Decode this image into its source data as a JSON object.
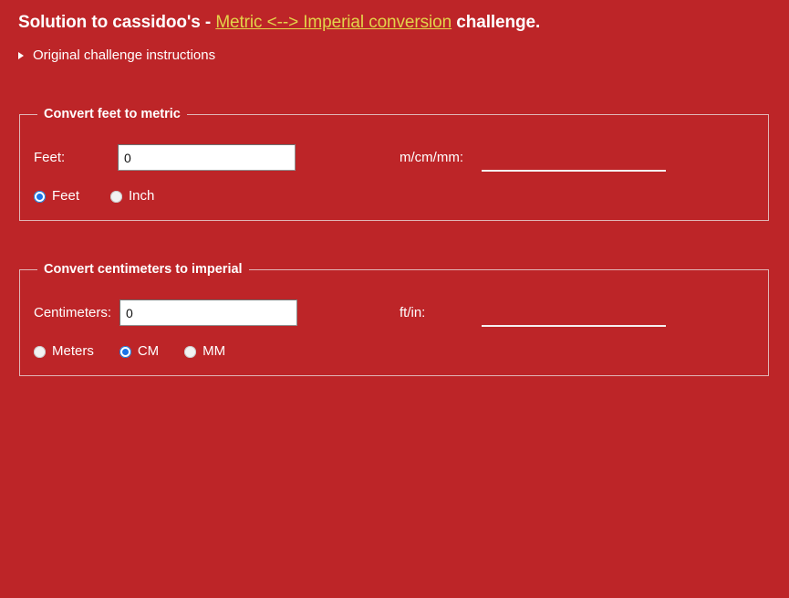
{
  "heading": {
    "prefix": "Solution to cassidoo's - ",
    "link_text": "Metric <--> Imperial conversion",
    "suffix": " challenge.",
    "link_color": "#e3d34a"
  },
  "details": {
    "summary_label": "Original challenge instructions",
    "marker_icon": "disclosure-triangle-closed-icon",
    "expanded": "false"
  },
  "theme": {
    "background": "#bd2528",
    "text": "#ffffff",
    "border": "#e0b6b6",
    "accent_radio": "#1a73e8",
    "input_background": "#ffffff"
  },
  "feet_section": {
    "legend": "Convert feet to metric",
    "input_label": "Feet:",
    "input_value": "0",
    "input_placeholder": "",
    "output_label": "m/cm/mm:",
    "output_value": "",
    "units": [
      {
        "label": "Feet",
        "checked": true
      },
      {
        "label": "Inch",
        "checked": false
      }
    ]
  },
  "cm_section": {
    "legend": "Convert centimeters to imperial",
    "input_label": "Centimeters:",
    "input_value": "0",
    "input_placeholder": "",
    "output_label": "ft/in:",
    "output_value": "",
    "units": [
      {
        "label": "Meters",
        "checked": false
      },
      {
        "label": "CM",
        "checked": true
      },
      {
        "label": "MM",
        "checked": false
      }
    ]
  }
}
